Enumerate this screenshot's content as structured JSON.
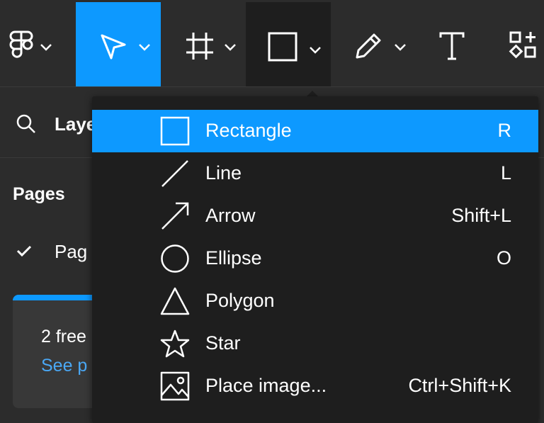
{
  "toolbar": {
    "main_menu_icon": "figma-logo-icon",
    "move_tool_icon": "pointer-arrow-icon",
    "frame_tool_icon": "frame-hash-icon",
    "shape_tool_icon": "square-icon",
    "pen_tool_icon": "pencil-icon",
    "text_tool_icon": "text-t-icon",
    "resources_icon": "shapes-plus-icon",
    "dropdown_icon": "chevron-down-icon",
    "active_color": "#0d99ff"
  },
  "left_panel": {
    "search_icon": "search-icon",
    "layers_label": "Laye",
    "pages_heading": "Pages",
    "current_page": "Pag",
    "check_icon": "checkmark-icon"
  },
  "promo": {
    "text": "2 free",
    "link": "See p"
  },
  "shape_menu": {
    "items": [
      {
        "label": "Rectangle",
        "shortcut": "R",
        "icon": "rectangle-icon",
        "highlighted": true
      },
      {
        "label": "Line",
        "shortcut": "L",
        "icon": "line-icon"
      },
      {
        "label": "Arrow",
        "shortcut": "Shift+L",
        "icon": "arrow-icon"
      },
      {
        "label": "Ellipse",
        "shortcut": "O",
        "icon": "ellipse-icon"
      },
      {
        "label": "Polygon",
        "shortcut": "",
        "icon": "polygon-icon"
      },
      {
        "label": "Star",
        "shortcut": "",
        "icon": "star-icon"
      },
      {
        "label": "Place image...",
        "shortcut": "Ctrl+Shift+K",
        "icon": "image-icon"
      }
    ]
  }
}
